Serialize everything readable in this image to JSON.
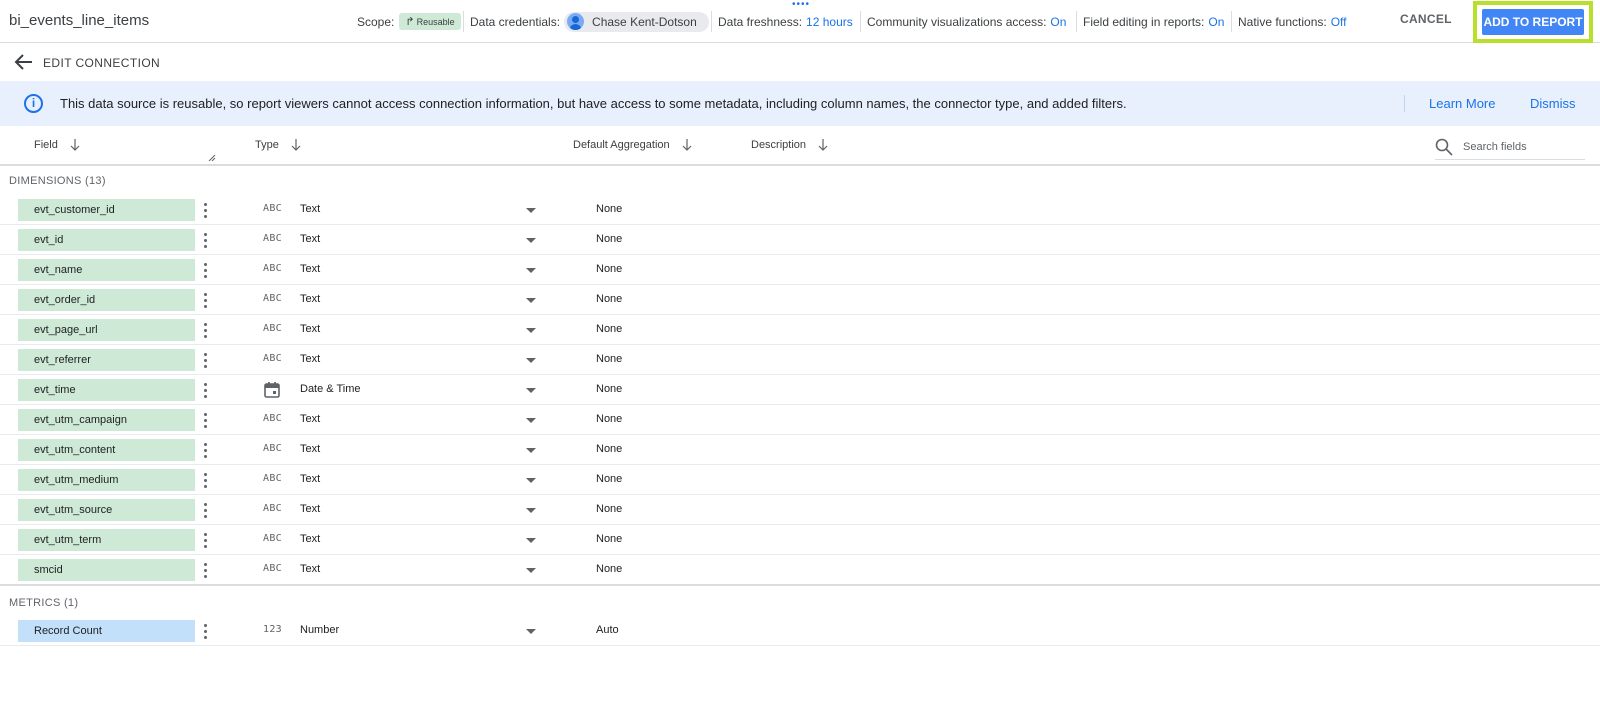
{
  "header": {
    "title": "bi_events_line_items",
    "scope_label": "Scope:",
    "scope_chip": "Reusable",
    "credentials_label": "Data credentials:",
    "credentials_user": "Chase Kent-Dotson",
    "freshness_label": "Data freshness:",
    "freshness_value": "12 hours",
    "community_label": "Community visualizations access:",
    "community_value": "On",
    "field_editing_label": "Field editing in reports:",
    "field_editing_value": "On",
    "native_label": "Native functions:",
    "native_value": "Off",
    "cancel_label": "CANCEL",
    "add_label": "ADD TO REPORT",
    "highlight_color": "#b8e02a"
  },
  "edit_connection": {
    "label": "EDIT CONNECTION"
  },
  "banner": {
    "text": "This data source is reusable, so report viewers cannot access connection information, but have access to some metadata, including column names, the connector type, and added filters.",
    "learn_more": "Learn More",
    "dismiss": "Dismiss"
  },
  "columns": {
    "field": "Field",
    "type": "Type",
    "aggregation": "Default Aggregation",
    "description": "Description"
  },
  "search": {
    "placeholder": "Search fields"
  },
  "dimensions": {
    "label": "DIMENSIONS (13)",
    "rows": [
      {
        "name": "evt_customer_id",
        "type_icon": "ABC",
        "type": "Text",
        "agg": "None"
      },
      {
        "name": "evt_id",
        "type_icon": "ABC",
        "type": "Text",
        "agg": "None"
      },
      {
        "name": "evt_name",
        "type_icon": "ABC",
        "type": "Text",
        "agg": "None"
      },
      {
        "name": "evt_order_id",
        "type_icon": "ABC",
        "type": "Text",
        "agg": "None"
      },
      {
        "name": "evt_page_url",
        "type_icon": "ABC",
        "type": "Text",
        "agg": "None"
      },
      {
        "name": "evt_referrer",
        "type_icon": "ABC",
        "type": "Text",
        "agg": "None"
      },
      {
        "name": "evt_time",
        "type_icon": "calendar-icon",
        "type": "Date & Time",
        "agg": "None"
      },
      {
        "name": "evt_utm_campaign",
        "type_icon": "ABC",
        "type": "Text",
        "agg": "None"
      },
      {
        "name": "evt_utm_content",
        "type_icon": "ABC",
        "type": "Text",
        "agg": "None"
      },
      {
        "name": "evt_utm_medium",
        "type_icon": "ABC",
        "type": "Text",
        "agg": "None"
      },
      {
        "name": "evt_utm_source",
        "type_icon": "ABC",
        "type": "Text",
        "agg": "None"
      },
      {
        "name": "evt_utm_term",
        "type_icon": "ABC",
        "type": "Text",
        "agg": "None"
      },
      {
        "name": "smcid",
        "type_icon": "ABC",
        "type": "Text",
        "agg": "None"
      }
    ]
  },
  "metrics": {
    "label": "METRICS (1)",
    "rows": [
      {
        "name": "Record Count",
        "type_icon": "123",
        "type": "Number",
        "agg": "Auto"
      }
    ]
  },
  "colors": {
    "dimension_chip": "#ceead6",
    "metric_chip": "#c2e0fa",
    "accent": "#1a73e8",
    "banner_bg": "#e8f0fe"
  }
}
